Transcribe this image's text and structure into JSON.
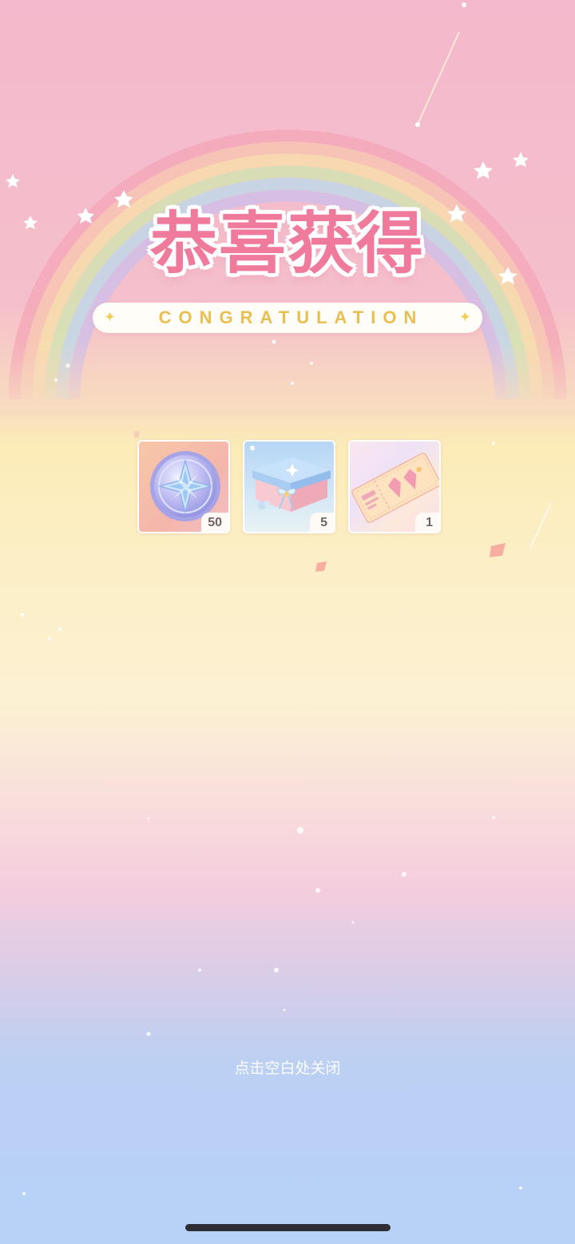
{
  "title": {
    "chinese": "恭喜获得",
    "english": "CONGRATULATION"
  },
  "rewards": [
    {
      "name": "star-crystal-coin",
      "count": "50"
    },
    {
      "name": "gift-box",
      "count": "5"
    },
    {
      "name": "ticket",
      "count": "1"
    }
  ],
  "close_hint": "点击空白处关闭",
  "colors": {
    "title_pink": "#f07a9c",
    "english_gold": "#eabf52",
    "background_top": "#f4b9cc",
    "background_bottom": "#b7d1f7"
  }
}
